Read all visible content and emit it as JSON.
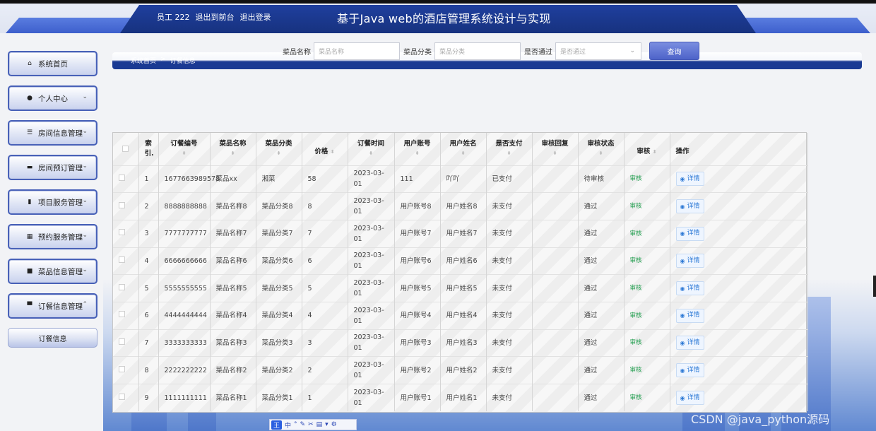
{
  "header": {
    "user_label": "员工 222",
    "back_link": "退出到前台",
    "logout_link": "退出登录",
    "title": "基于Java web的酒店管理系统设计与实现"
  },
  "sidebar": {
    "items": [
      {
        "label": "系统首页",
        "icon": "home-icon",
        "has_chevron": false
      },
      {
        "label": "个人中心",
        "icon": "user-icon",
        "has_chevron": true
      },
      {
        "label": "房间信息管理",
        "icon": "sliders-icon",
        "has_chevron": true
      },
      {
        "label": "房间预订管理",
        "icon": "chat-icon",
        "has_chevron": true
      },
      {
        "label": "项目服务管理",
        "icon": "chart-icon",
        "has_chevron": true
      },
      {
        "label": "预约服务管理",
        "icon": "grid-icon",
        "has_chevron": true
      },
      {
        "label": "菜品信息管理",
        "icon": "video-icon",
        "has_chevron": true
      },
      {
        "label": "订餐信息管理",
        "icon": "briefcase-icon",
        "has_chevron": true
      }
    ],
    "sub_item": "订餐信息"
  },
  "breadcrumb": {
    "home": "系统首页",
    "sep": ">",
    "current": "订餐信息"
  },
  "search": {
    "dish_name_label": "菜品名称",
    "dish_name_placeholder": "菜品名称",
    "dish_category_label": "菜品分类",
    "dish_category_placeholder": "菜品分类",
    "paid_label": "是否通过",
    "paid_placeholder": "是否通过",
    "query_button": "查询"
  },
  "table": {
    "headers": {
      "index": "索引.",
      "order_no": "订餐编号",
      "dish_name": "菜品名称",
      "dish_category": "菜品分类",
      "price": "价格",
      "order_time": "订餐时间",
      "user_account": "用户账号",
      "user_name": "用户姓名",
      "is_paid": "是否支付",
      "audit_reply": "审核回复",
      "audit_status": "审核状态",
      "audit": "审核",
      "actions": "操作"
    },
    "audit_link": "审核",
    "detail_button": "详情",
    "rows": [
      {
        "index": "1",
        "order_no": "1677663989578",
        "dish_name": "菜品xx",
        "dish_category": "湘菜",
        "price": "58",
        "order_time": "2023-03-01",
        "user_account": "111",
        "user_name": "吖吖",
        "is_paid": "已支付",
        "audit_reply": "",
        "audit_status": "待审核"
      },
      {
        "index": "2",
        "order_no": "8888888888",
        "dish_name": "菜品名称8",
        "dish_category": "菜品分类8",
        "price": "8",
        "order_time": "2023-03-01",
        "user_account": "用户账号8",
        "user_name": "用户姓名8",
        "is_paid": "未支付",
        "audit_reply": "",
        "audit_status": "通过"
      },
      {
        "index": "3",
        "order_no": "7777777777",
        "dish_name": "菜品名称7",
        "dish_category": "菜品分类7",
        "price": "7",
        "order_time": "2023-03-01",
        "user_account": "用户账号7",
        "user_name": "用户姓名7",
        "is_paid": "未支付",
        "audit_reply": "",
        "audit_status": "通过"
      },
      {
        "index": "4",
        "order_no": "6666666666",
        "dish_name": "菜品名称6",
        "dish_category": "菜品分类6",
        "price": "6",
        "order_time": "2023-03-01",
        "user_account": "用户账号6",
        "user_name": "用户姓名6",
        "is_paid": "未支付",
        "audit_reply": "",
        "audit_status": "通过"
      },
      {
        "index": "5",
        "order_no": "5555555555",
        "dish_name": "菜品名称5",
        "dish_category": "菜品分类5",
        "price": "5",
        "order_time": "2023-03-01",
        "user_account": "用户账号5",
        "user_name": "用户姓名5",
        "is_paid": "未支付",
        "audit_reply": "",
        "audit_status": "通过"
      },
      {
        "index": "6",
        "order_no": "4444444444",
        "dish_name": "菜品名称4",
        "dish_category": "菜品分类4",
        "price": "4",
        "order_time": "2023-03-01",
        "user_account": "用户账号4",
        "user_name": "用户姓名4",
        "is_paid": "未支付",
        "audit_reply": "",
        "audit_status": "通过"
      },
      {
        "index": "7",
        "order_no": "3333333333",
        "dish_name": "菜品名称3",
        "dish_category": "菜品分类3",
        "price": "3",
        "order_time": "2023-03-01",
        "user_account": "用户账号3",
        "user_name": "用户姓名3",
        "is_paid": "未支付",
        "audit_reply": "",
        "audit_status": "通过"
      },
      {
        "index": "8",
        "order_no": "2222222222",
        "dish_name": "菜品名称2",
        "dish_category": "菜品分类2",
        "price": "2",
        "order_time": "2023-03-01",
        "user_account": "用户账号2",
        "user_name": "用户姓名2",
        "is_paid": "未支付",
        "audit_reply": "",
        "audit_status": "通过"
      },
      {
        "index": "9",
        "order_no": "1111111111",
        "dish_name": "菜品名称1",
        "dish_category": "菜品分类1",
        "price": "1",
        "order_time": "2023-03-01",
        "user_account": "用户账号1",
        "user_name": "用户姓名1",
        "is_paid": "未支付",
        "audit_reply": "",
        "audit_status": "通过"
      }
    ]
  },
  "ime": {
    "logo": "王",
    "mode": "中"
  },
  "watermark": "CSDN @java_python源码",
  "colors": {
    "header_blue": "#1f3f9e",
    "audit_green": "#1e9d4c",
    "detail_blue": "#2e7ad6",
    "query_button": "#4d63c9"
  }
}
